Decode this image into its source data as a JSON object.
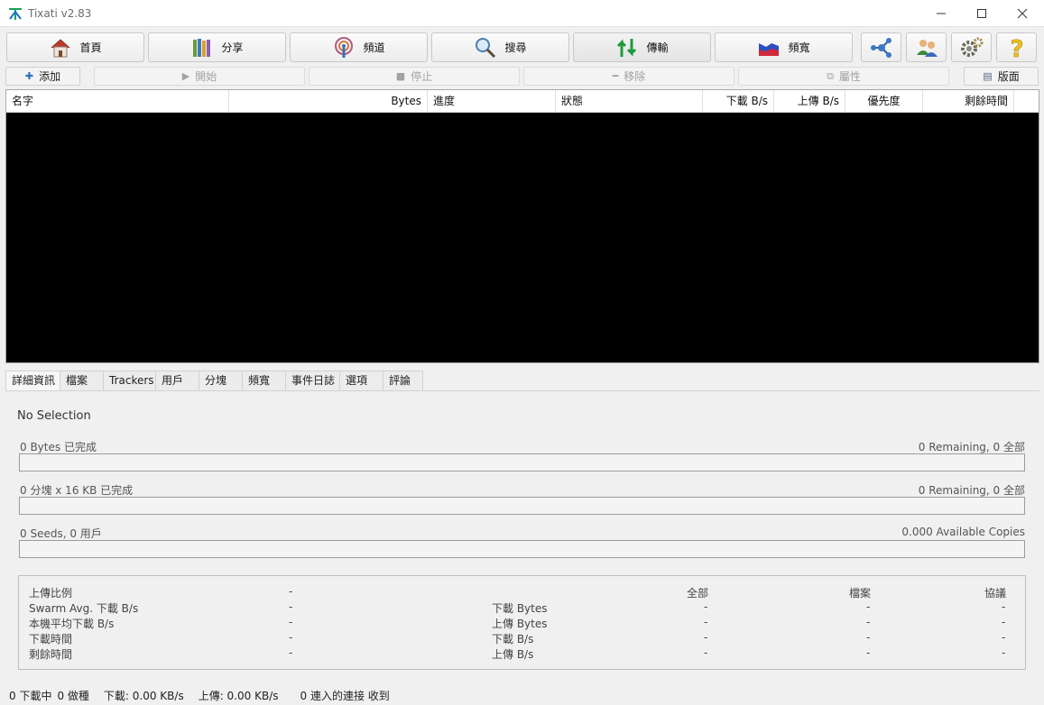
{
  "window": {
    "title": "Tixati v2.83"
  },
  "nav": {
    "home": "首頁",
    "share": "分享",
    "channels": "頻道",
    "search": "搜尋",
    "transfers": "傳輸",
    "bandwidth": "頻寬"
  },
  "toolbar": {
    "add": "添加",
    "start": "開始",
    "stop": "停止",
    "remove": "移除",
    "properties": "屬性",
    "layout": "版面"
  },
  "table": {
    "columns": [
      "名字",
      "Bytes",
      "進度",
      "狀態",
      "下載 B/s",
      "上傳 B/s",
      "優先度",
      "剩餘時間"
    ],
    "rows": []
  },
  "tabs": [
    "詳細資訊",
    "檔案",
    "Trackers",
    "用戶",
    "分塊",
    "頻寬",
    "事件日誌",
    "選項",
    "評論"
  ],
  "details": {
    "selection": "No Selection",
    "bytes_done": "0 Bytes 已完成",
    "bytes_remaining": "0 Remaining,  0 全部",
    "pieces_done": "0 分塊  x  16 KB 已完成",
    "pieces_remaining": "0 Remaining,  0 全部",
    "seeds_peers": "0 Seeds, 0 用戶",
    "available_copies": "0.000 Available Copies",
    "stats": {
      "left_labels": [
        "上傳比例",
        "Swarm Avg. 下載 B/s",
        "本機平均下載 B/s",
        "下載時間",
        "剩餘時間"
      ],
      "left_values": [
        "-",
        "-",
        "-",
        "-",
        "-"
      ],
      "col_headers": [
        "全部",
        "檔案",
        "協議"
      ],
      "row_labels": [
        "下載 Bytes",
        "上傳 Bytes",
        "下載 B/s",
        "上傳 B/s"
      ],
      "dash": "-"
    }
  },
  "status": {
    "downloading": "0 下載中",
    "seeding": "0 做種",
    "download_rate": "下載: 0.00 KB/s",
    "upload_rate": "上傳: 0.00 KB/s",
    "incoming": "0 連入的連接 收到"
  }
}
